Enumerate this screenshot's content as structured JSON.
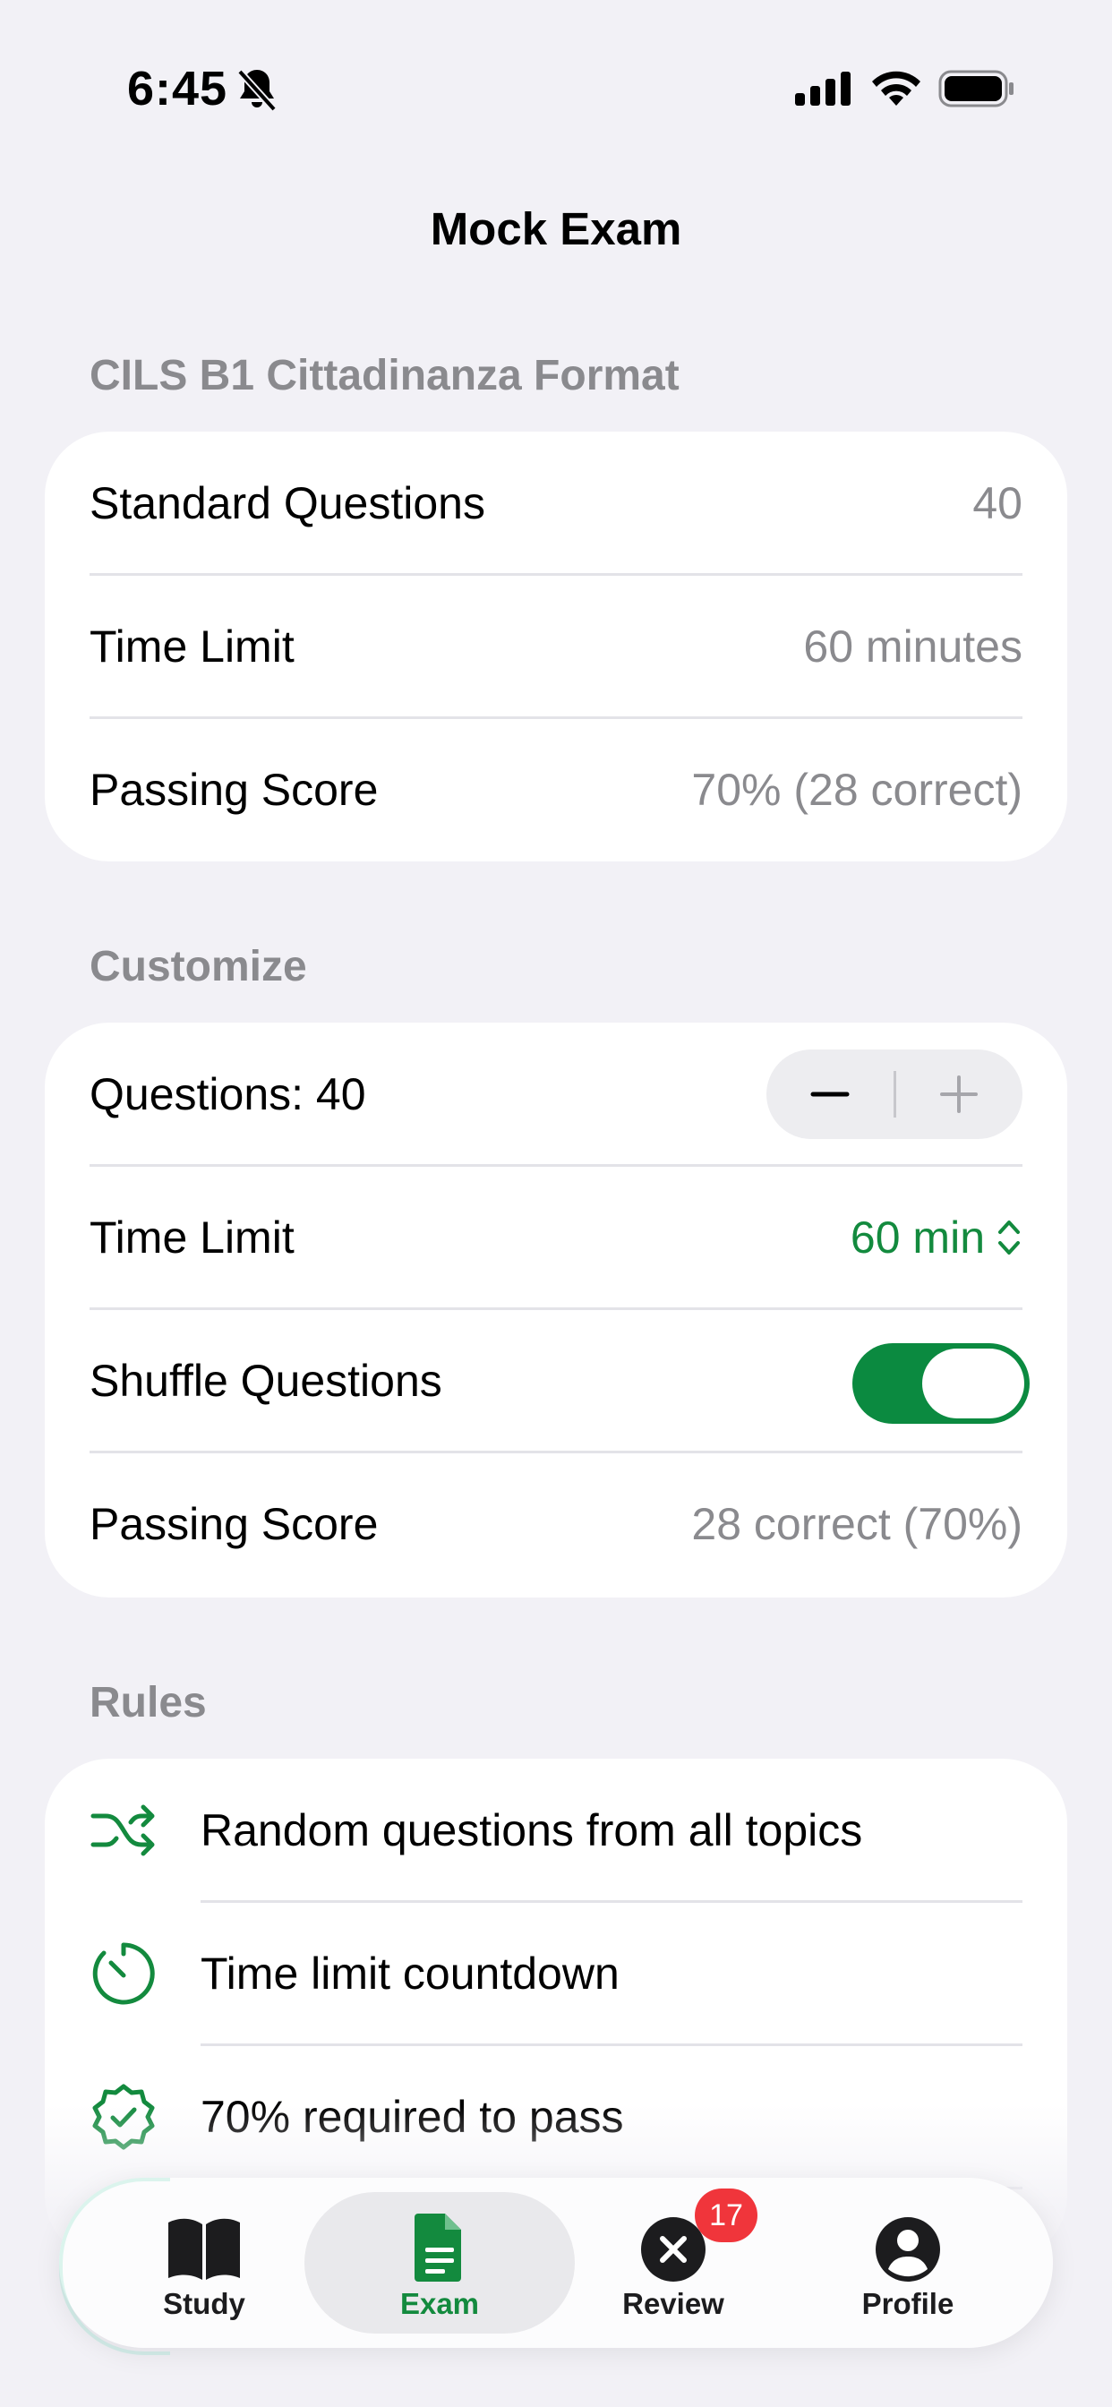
{
  "status_bar": {
    "time": "6:45"
  },
  "nav": {
    "title": "Mock Exam"
  },
  "format_section": {
    "header": "CILS B1 Cittadinanza Format",
    "rows": [
      {
        "label": "Standard Questions",
        "value": "40"
      },
      {
        "label": "Time Limit",
        "value": "60 minutes"
      },
      {
        "label": "Passing Score",
        "value": "70% (28 correct)"
      }
    ]
  },
  "customize_section": {
    "header": "Customize",
    "questions_label": "Questions: 40",
    "stepper": {
      "minus": "−",
      "plus": "+"
    },
    "time_limit_label": "Time Limit",
    "time_limit_value": "60 min",
    "shuffle_label": "Shuffle Questions",
    "shuffle_on": true,
    "passing_label": "Passing Score",
    "passing_value": "28 correct (70%)"
  },
  "rules_section": {
    "header": "Rules",
    "items": [
      {
        "icon": "shuffle-icon",
        "text": "Random questions from all topics"
      },
      {
        "icon": "timer-icon",
        "text": "Time limit countdown"
      },
      {
        "icon": "checkmark-seal-icon",
        "text": "70% required to pass"
      }
    ]
  },
  "tab_bar": {
    "tabs": [
      {
        "label": "Study",
        "icon": "book-icon"
      },
      {
        "label": "Exam",
        "icon": "document-icon",
        "active": true
      },
      {
        "label": "Review",
        "icon": "xmark-circle-icon",
        "badge": "17"
      },
      {
        "label": "Profile",
        "icon": "person-circle-icon"
      }
    ]
  },
  "colors": {
    "accent": "#138A3E",
    "toggle": "#0B8A40",
    "badge": "#F0353B",
    "background": "#F2F1F6"
  }
}
